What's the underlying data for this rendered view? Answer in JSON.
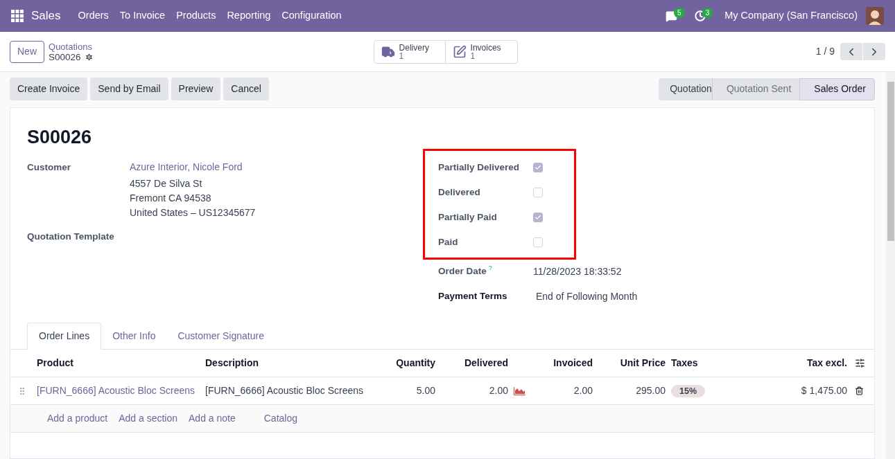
{
  "navbar": {
    "app": "Sales",
    "menu": [
      "Orders",
      "To Invoice",
      "Products",
      "Reporting",
      "Configuration"
    ],
    "messages_count": "5",
    "activities_count": "3",
    "company": "My Company (San Francisco)"
  },
  "control_panel": {
    "new_button": "New",
    "breadcrumb": "Quotations",
    "record": "S00026",
    "smart_buttons": [
      {
        "kind": "delivery",
        "label": "Delivery",
        "value": "1"
      },
      {
        "kind": "invoices",
        "label": "Invoices",
        "value": "1"
      }
    ],
    "pager": "1 / 9"
  },
  "actions": [
    "Create Invoice",
    "Send by Email",
    "Preview",
    "Cancel"
  ],
  "stages": [
    {
      "label": "Quotation",
      "selected": false
    },
    {
      "label": "Quotation Sent",
      "selected": false
    },
    {
      "label": "Sales Order",
      "selected": true
    }
  ],
  "form": {
    "title": "S00026",
    "customer_label": "Customer",
    "customer_name": "Azure Interior, Nicole Ford",
    "address": [
      "4557 De Silva St",
      "Fremont CA 94538",
      "United States – US12345677"
    ],
    "template_label": "Quotation Template",
    "flags": [
      {
        "label": "Partially Delivered",
        "checked": true
      },
      {
        "label": "Delivered",
        "checked": false
      },
      {
        "label": "Partially Paid",
        "checked": true
      },
      {
        "label": "Paid",
        "checked": false
      }
    ],
    "order_date_label": "Order Date",
    "order_date_help": "?",
    "order_date": "11/28/2023 18:33:52",
    "payment_terms_label": "Payment Terms",
    "payment_terms": "End of Following Month"
  },
  "tabs": [
    {
      "label": "Order Lines",
      "selected": true
    },
    {
      "label": "Other Info",
      "selected": false
    },
    {
      "label": "Customer Signature",
      "selected": false
    }
  ],
  "table": {
    "columns": [
      "Product",
      "Description",
      "Quantity",
      "Delivered",
      "Invoiced",
      "Unit Price",
      "Taxes",
      "Tax excl."
    ],
    "rows": [
      {
        "product": "[FURN_6666] Acoustic Bloc Screens",
        "description": "[FURN_6666] Acoustic Bloc Screens",
        "quantity": "5.00",
        "delivered": "2.00",
        "invoiced": "2.00",
        "unit_price": "295.00",
        "tax": "15%",
        "subtotal": "$ 1,475.00"
      }
    ],
    "add_links": [
      "Add a product",
      "Add a section",
      "Add a note",
      "Catalog"
    ]
  }
}
